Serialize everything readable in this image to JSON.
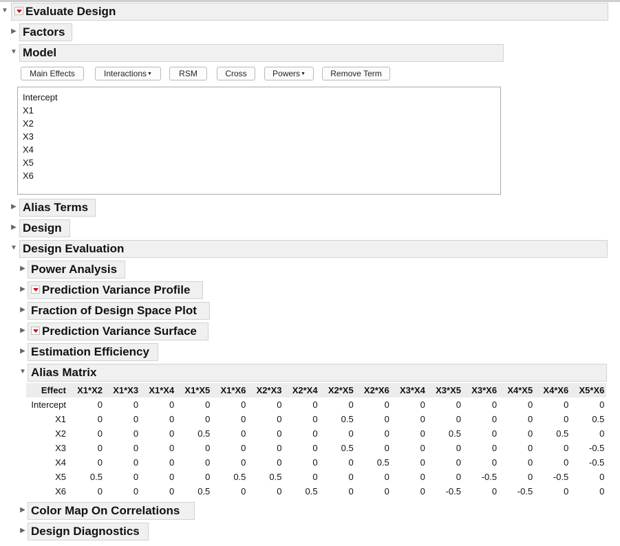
{
  "report": {
    "title": "Evaluate Design",
    "factors": "Factors",
    "model": "Model",
    "model_buttons": [
      "Main Effects",
      "Interactions",
      "RSM",
      "Cross",
      "Powers",
      "Remove Term"
    ],
    "model_terms": [
      "Intercept",
      "X1",
      "X2",
      "X3",
      "X4",
      "X5",
      "X6"
    ],
    "alias_terms": "Alias Terms",
    "design": "Design",
    "design_evaluation": "Design Evaluation",
    "power_analysis": "Power Analysis",
    "prediction_variance_profile": "Prediction Variance Profile",
    "fraction_design_space": "Fraction of Design Space Plot",
    "prediction_variance_surface": "Prediction Variance Surface",
    "estimation_efficiency": "Estimation Efficiency",
    "alias_matrix": "Alias Matrix",
    "color_map": "Color Map On Correlations",
    "design_diagnostics": "Design Diagnostics"
  },
  "alias_table": {
    "corner": "Effect",
    "columns": [
      "X1*X2",
      "X1*X3",
      "X1*X4",
      "X1*X5",
      "X1*X6",
      "X2*X3",
      "X2*X4",
      "X2*X5",
      "X2*X6",
      "X3*X4",
      "X3*X5",
      "X3*X6",
      "X4*X5",
      "X4*X6",
      "X5*X6"
    ],
    "rows": [
      {
        "label": "Intercept",
        "values": [
          "0",
          "0",
          "0",
          "0",
          "0",
          "0",
          "0",
          "0",
          "0",
          "0",
          "0",
          "0",
          "0",
          "0",
          "0"
        ]
      },
      {
        "label": "X1",
        "values": [
          "0",
          "0",
          "0",
          "0",
          "0",
          "0",
          "0",
          "0.5",
          "0",
          "0",
          "0",
          "0",
          "0",
          "0",
          "0.5"
        ]
      },
      {
        "label": "X2",
        "values": [
          "0",
          "0",
          "0",
          "0.5",
          "0",
          "0",
          "0",
          "0",
          "0",
          "0",
          "0.5",
          "0",
          "0",
          "0.5",
          "0"
        ]
      },
      {
        "label": "X3",
        "values": [
          "0",
          "0",
          "0",
          "0",
          "0",
          "0",
          "0",
          "0.5",
          "0",
          "0",
          "0",
          "0",
          "0",
          "0",
          "-0.5"
        ]
      },
      {
        "label": "X4",
        "values": [
          "0",
          "0",
          "0",
          "0",
          "0",
          "0",
          "0",
          "0",
          "0.5",
          "0",
          "0",
          "0",
          "0",
          "0",
          "-0.5"
        ]
      },
      {
        "label": "X5",
        "values": [
          "0.5",
          "0",
          "0",
          "0",
          "0.5",
          "0.5",
          "0",
          "0",
          "0",
          "0",
          "0",
          "-0.5",
          "0",
          "-0.5",
          "0"
        ]
      },
      {
        "label": "X6",
        "values": [
          "0",
          "0",
          "0",
          "0.5",
          "0",
          "0",
          "0.5",
          "0",
          "0",
          "0",
          "-0.5",
          "0",
          "-0.5",
          "0",
          "0"
        ]
      }
    ]
  }
}
